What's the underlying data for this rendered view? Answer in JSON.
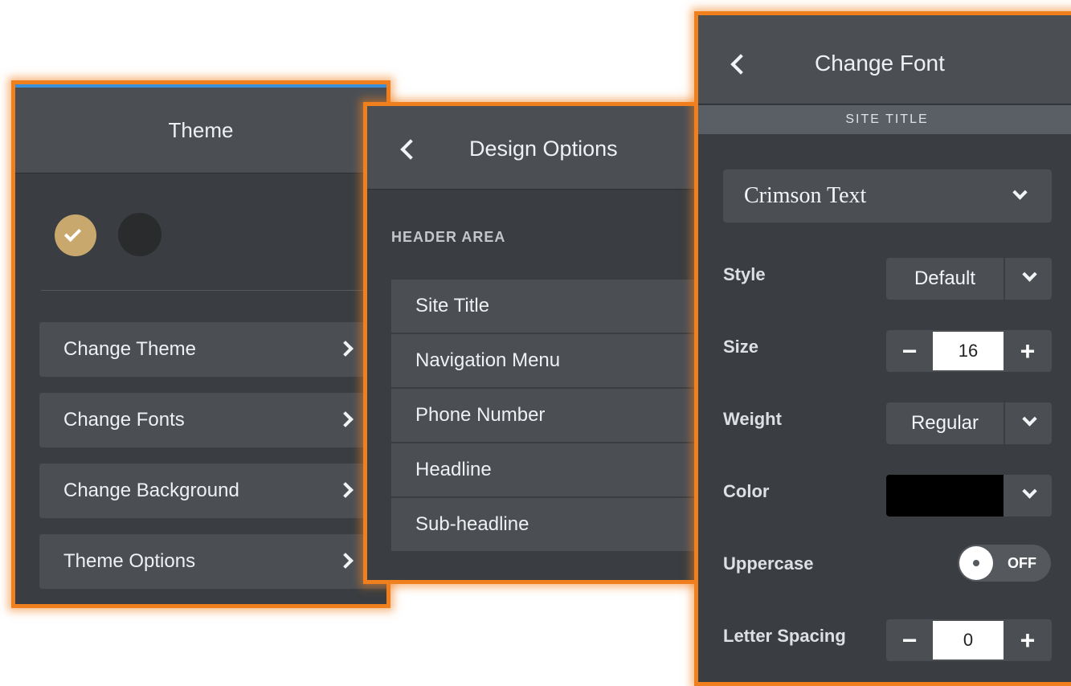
{
  "theme_panel": {
    "title": "Theme",
    "swatches": [
      {
        "color": "#c9a86e",
        "selected": true
      },
      {
        "color": "#2a2b2d",
        "selected": false
      }
    ],
    "items": [
      "Change Theme",
      "Change Fonts",
      "Change Background",
      "Theme Options"
    ]
  },
  "design_panel": {
    "title": "Design Options",
    "section_label": "HEADER AREA",
    "items": [
      "Site Title",
      "Navigation Menu",
      "Phone Number",
      "Headline",
      "Sub-headline"
    ]
  },
  "font_panel": {
    "title": "Change Font",
    "subtitle": "SITE TITLE",
    "font": "Crimson Text",
    "style": {
      "label": "Style",
      "value": "Default"
    },
    "size": {
      "label": "Size",
      "value": "16",
      "minus": "−",
      "plus": "+"
    },
    "weight": {
      "label": "Weight",
      "value": "Regular"
    },
    "color": {
      "label": "Color",
      "value": "#000000"
    },
    "uppercase": {
      "label": "Uppercase",
      "state": "OFF"
    },
    "letter_spacing": {
      "label": "Letter Spacing",
      "value": "0",
      "minus": "−",
      "plus": "+"
    }
  },
  "colors": {
    "accent_orange": "#f07f1e",
    "accent_blue": "#3a8fd9",
    "panel_bg": "#3a3d41"
  }
}
